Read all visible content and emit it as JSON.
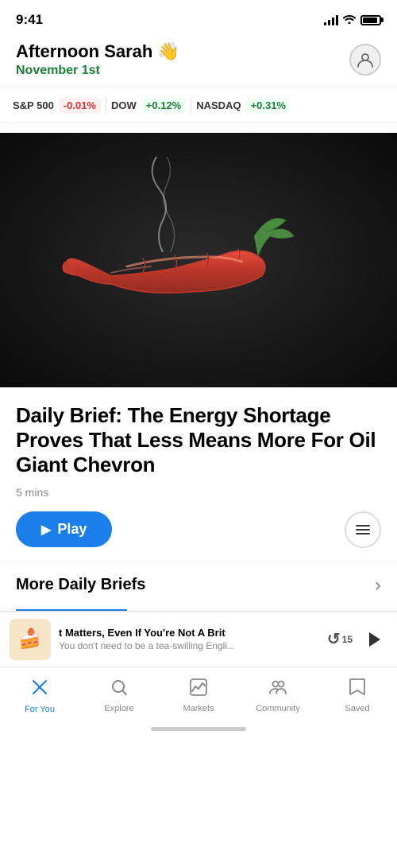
{
  "statusBar": {
    "time": "9:41"
  },
  "header": {
    "greeting": "Afternoon Sarah 👋",
    "date": "November 1st",
    "avatarLabel": "User profile"
  },
  "ticker": {
    "items": [
      {
        "name": "S&P 500",
        "change": "-0.01%",
        "type": "negative"
      },
      {
        "name": "DOW",
        "change": "+0.12%",
        "type": "positive"
      },
      {
        "name": "NASDAQ",
        "change": "+0.31%",
        "type": "positive"
      }
    ]
  },
  "heroArticle": {
    "title": "Daily Brief: The Energy Shortage Proves That Less Means More For Oil Giant Chevron",
    "readTime": "5 mins",
    "playLabel": "▶ Play",
    "playButtonLabel": "Play",
    "listButtonLabel": "List options"
  },
  "moreBriefs": {
    "label": "More Daily Briefs",
    "chevron": "›"
  },
  "miniPlayer": {
    "titleText": "t Matters, Even If You're Not A Brit",
    "subtitle": "You don't need to be a tea-swilling Engli...",
    "replaySeconds": "15",
    "thumbnail": "🍰"
  },
  "tabBar": {
    "tabs": [
      {
        "id": "for-you",
        "label": "For You",
        "icon": "✦",
        "active": true
      },
      {
        "id": "explore",
        "label": "Explore",
        "icon": "🔍",
        "active": false
      },
      {
        "id": "markets",
        "label": "Markets",
        "icon": "📊",
        "active": false
      },
      {
        "id": "community",
        "label": "Community",
        "icon": "👥",
        "active": false
      },
      {
        "id": "saved",
        "label": "Saved",
        "icon": "🔖",
        "active": false
      }
    ]
  },
  "colors": {
    "accent": "#1a7fe8",
    "positive": "#1a7f37",
    "negative": "#e03131"
  }
}
